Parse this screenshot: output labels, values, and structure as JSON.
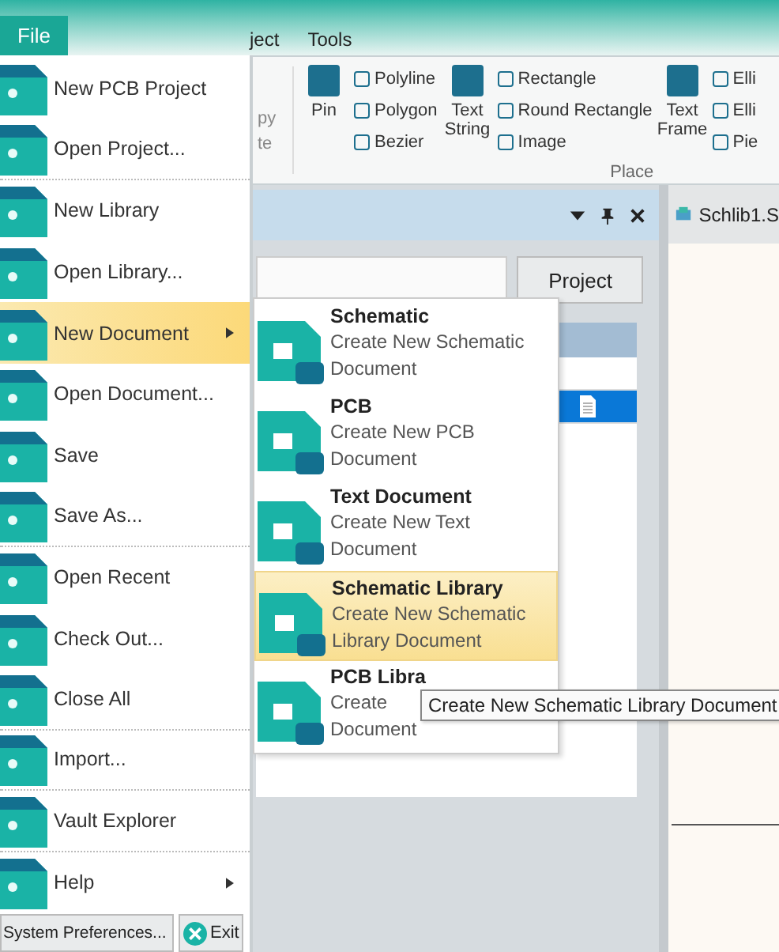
{
  "menu_bar": {
    "tabs": [
      {
        "label": "ject"
      },
      {
        "label": "Tools"
      }
    ]
  },
  "ribbon": {
    "fragments": [
      "py",
      "te"
    ],
    "columns": [
      {
        "kind": "large",
        "items": [
          "Pin"
        ]
      },
      {
        "kind": "small",
        "items": [
          "Polyline",
          "Polygon",
          "Bezier"
        ]
      },
      {
        "kind": "large",
        "items": [
          "Text String"
        ]
      },
      {
        "kind": "small",
        "items": [
          "Rectangle",
          "Round Rectangle",
          "Image"
        ]
      },
      {
        "kind": "large",
        "items": [
          "Text Frame"
        ]
      },
      {
        "kind": "small",
        "items": [
          "Elli",
          "Elli",
          "Pie"
        ]
      }
    ],
    "group_label": "Place"
  },
  "panel": {
    "project_button": "Project"
  },
  "document_tab": "Schlib1.S",
  "file_menu": {
    "title": "File",
    "items": [
      {
        "label": "New PCB Project",
        "submenu": false,
        "selected": false,
        "divider_after": false
      },
      {
        "label": "Open Project...",
        "submenu": false,
        "selected": false,
        "divider_after": true
      },
      {
        "label": "New Library",
        "submenu": false,
        "selected": false,
        "divider_after": false
      },
      {
        "label": "Open Library...",
        "submenu": false,
        "selected": false,
        "divider_after": false
      },
      {
        "label": "New Document",
        "submenu": true,
        "selected": true,
        "divider_after": false
      },
      {
        "label": "Open Document...",
        "submenu": false,
        "selected": false,
        "divider_after": false
      },
      {
        "label": "Save",
        "submenu": false,
        "selected": false,
        "divider_after": false
      },
      {
        "label": "Save As...",
        "submenu": false,
        "selected": false,
        "divider_after": true
      },
      {
        "label": "Open Recent",
        "submenu": false,
        "selected": false,
        "divider_after": false
      },
      {
        "label": "Check Out...",
        "submenu": false,
        "selected": false,
        "divider_after": false
      },
      {
        "label": "Close All",
        "submenu": false,
        "selected": false,
        "divider_after": true
      },
      {
        "label": "Import...",
        "submenu": false,
        "selected": false,
        "divider_after": true
      },
      {
        "label": "Vault Explorer",
        "submenu": false,
        "selected": false,
        "divider_after": true
      },
      {
        "label": "Help",
        "submenu": true,
        "selected": false,
        "divider_after": false
      }
    ],
    "footer_buttons": [
      "System Preferences...",
      "Exit"
    ]
  },
  "submenu": {
    "items": [
      {
        "title": "Schematic",
        "description_lines": [
          "Create New Schematic",
          "Document"
        ],
        "selected": false
      },
      {
        "title": "PCB",
        "description_lines": [
          "Create New PCB",
          "Document"
        ],
        "selected": false
      },
      {
        "title": "Text Document",
        "description_lines": [
          "Create New Text",
          "Document"
        ],
        "selected": false
      },
      {
        "title": "Schematic Library",
        "description_lines": [
          "Create New Schematic",
          "Library Document"
        ],
        "selected": true
      },
      {
        "title": "PCB Libra",
        "description_lines": [
          "Create",
          "Document"
        ],
        "selected": false
      }
    ]
  },
  "tooltip": "Create New Schematic Library Document"
}
